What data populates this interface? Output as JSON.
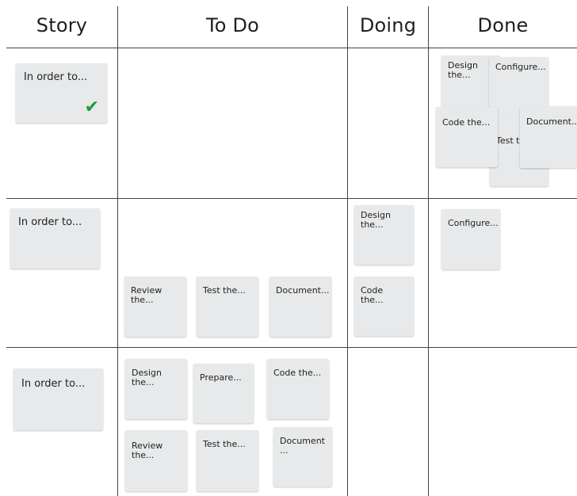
{
  "columns": {
    "story": "Story",
    "todo": "To Do",
    "doing": "Doing",
    "done": "Done"
  },
  "rows": [
    {
      "story": "In order to...",
      "story_done": true,
      "done": [
        "Design the...",
        "Configure...",
        "Code the...",
        "Test t",
        "Document..."
      ]
    },
    {
      "story": "In order to...",
      "todo": [
        "Review the...",
        "Test the...",
        "Document..."
      ],
      "doing": [
        "Design the...",
        "Code the..."
      ],
      "done": [
        "Configure..."
      ]
    },
    {
      "story": "In order to...",
      "todo": [
        "Design the...",
        "Prepare...",
        "Code the...",
        "Review the...",
        "Test the...",
        "Document ..."
      ]
    }
  ],
  "icons": {
    "done_check": "check-icon",
    "check_color": "#1f9a3a"
  }
}
